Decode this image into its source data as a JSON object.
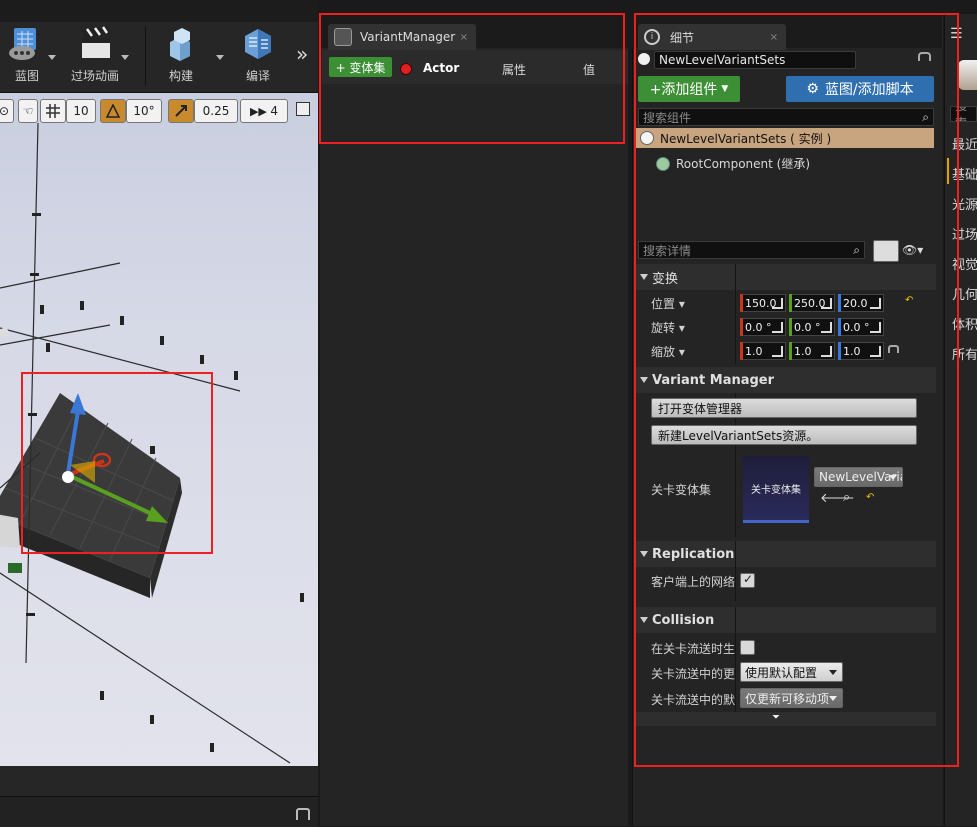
{
  "toolbar": {
    "blueprint_label": "蓝图",
    "cinematics_label": "过场动画",
    "build_label": "构建",
    "compile_label": "编译",
    "more_label": "»"
  },
  "viewport": {
    "grid_snap": "10",
    "rotation_snap": "10°",
    "scale_snap": "0.25",
    "camera_speed": "4"
  },
  "variant_manager": {
    "tab_title": "VariantManager",
    "add_variant_set_label": "+ 变体集",
    "col_actor": "Actor",
    "col_property": "属性",
    "col_value": "值"
  },
  "details": {
    "tab_title": "细节",
    "actor_name": "NewLevelVariantSets",
    "add_component_label": "+添加组件",
    "blueprint_button_label": "蓝图/添加脚本",
    "search_components_placeholder": "搜索组件",
    "component_instance": "NewLevelVariantSets ( 实例 )",
    "component_root": "RootComponent (继承)",
    "search_details_placeholder": "搜索详情",
    "transform_section": "变换",
    "location_label": "位置",
    "rotation_label": "旋转",
    "scale_label": "缩放",
    "location": [
      "150.0",
      "250.0",
      "20.0"
    ],
    "rotation": [
      "0.0 °",
      "0.0 °",
      "0.0 °"
    ],
    "scale": [
      "1.0",
      "1.0",
      "1.0"
    ],
    "vm_section": "Variant Manager",
    "open_vm_button": "打开变体管理器",
    "new_lvs_button": "新建LevelVariantSets资源。",
    "level_variant_sets_label": "关卡变体集",
    "thumbnail_label": "关卡变体集",
    "asset_combo": "NewLevelVaria",
    "replication_section": "Replication",
    "net_load_label": "客户端上的网络加",
    "collision_section": "Collision",
    "gen_overlap_label": "在关卡流送时生成",
    "update_overlap_label": "关卡流送中的更新",
    "update_overlap_value": "使用默认配置",
    "default_update_label": "关卡流送中的默认",
    "default_update_value": "仅更新可移动项"
  },
  "right_panel": {
    "search_placeholder": "搜索",
    "items": [
      "最近",
      "基础",
      "光源",
      "过场",
      "视觉",
      "几何",
      "体积",
      "所有"
    ]
  },
  "colors": {
    "x_axis": "#c8341c",
    "y_axis": "#5aa020",
    "z_axis": "#3a78d8",
    "green_button": "#3d8f36",
    "blue_button": "#2f6fb0",
    "annotation": "#ee2020",
    "snap_orange": "#c98a2e"
  }
}
